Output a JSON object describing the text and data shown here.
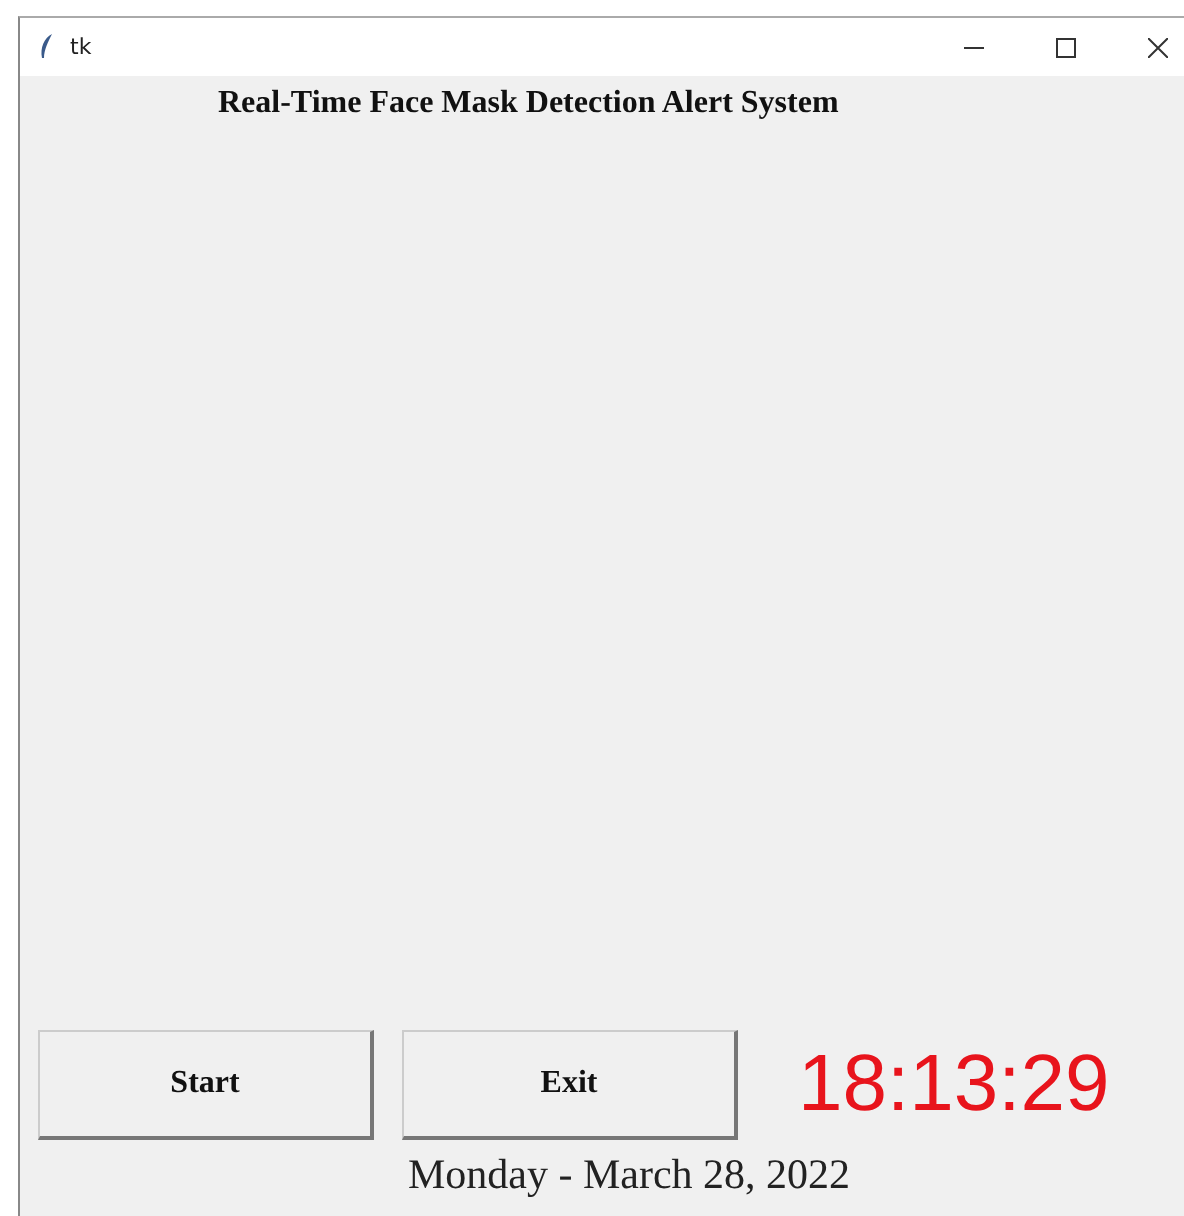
{
  "window": {
    "title": "tk"
  },
  "heading": "Real-Time Face Mask Detection Alert System",
  "buttons": [
    {
      "label": "Start"
    },
    {
      "label": "Exit"
    }
  ],
  "clock": "18:13:29",
  "date": "Monday - March 28, 2022"
}
